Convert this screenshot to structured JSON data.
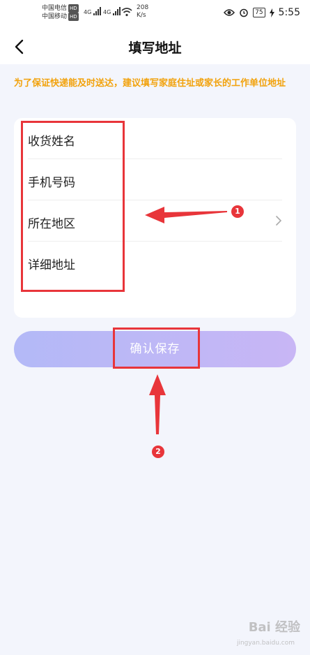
{
  "status_bar": {
    "carrier_1": "中国电信",
    "carrier_2": "中国移动",
    "hd_badge": "HD",
    "network_1": "4G",
    "network_2": "4G",
    "speed_value": "208",
    "speed_unit": "K/s",
    "battery": "75",
    "time": "5:55"
  },
  "header": {
    "title": "填写地址"
  },
  "notice": "为了保证快递能及时送达，建议填写家庭住址或家长的工作单位地址",
  "form": {
    "rows": [
      {
        "label": "收货姓名"
      },
      {
        "label": "手机号码"
      },
      {
        "label": "所在地区"
      },
      {
        "label": "详细地址"
      }
    ]
  },
  "save_button": {
    "label": "确认保存"
  },
  "annotations": {
    "marker_1": "1",
    "marker_2": "2",
    "color": "#e8353a"
  },
  "watermark": {
    "brand": "Bai 经验",
    "sub": "jingyan.baidu.com"
  },
  "colors": {
    "notice": "#f2a20c",
    "background": "#f3f5fc",
    "button_gradient_start": "#b3b9f7",
    "button_gradient_end": "#c8b6f5"
  }
}
